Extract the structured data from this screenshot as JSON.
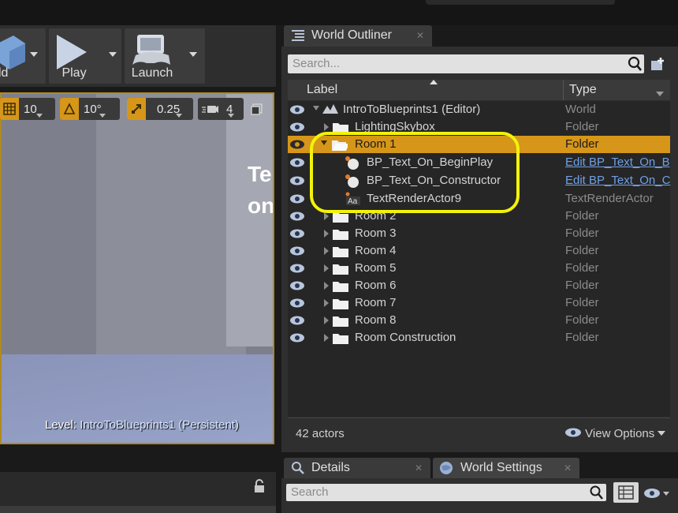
{
  "toolbar": {
    "buttons": [
      {
        "label": "ld"
      },
      {
        "label": "Play"
      },
      {
        "label": "Launch"
      }
    ]
  },
  "viewport": {
    "grid_snap_value": "10",
    "rotation_snap_value": "10°",
    "scale_snap_value": "0.25",
    "camera_speed_value": "4",
    "overlay_text_line1": "Te",
    "overlay_text_line2": "on",
    "level_prefix": "Level:",
    "level_name": "IntroToBlueprints1 (Persistent)"
  },
  "outliner": {
    "tab_title": "World Outliner",
    "search_placeholder": "Search...",
    "col_label": "Label",
    "col_type": "Type",
    "rows": [
      {
        "label": "IntroToBlueprints1 (Editor)",
        "type": "World"
      },
      {
        "label": "LightingSkybox",
        "type": "Folder"
      },
      {
        "label": "Room 1",
        "type": "Folder"
      },
      {
        "label": "BP_Text_On_BeginPlay",
        "type": "Edit BP_Text_On_B"
      },
      {
        "label": "BP_Text_On_Constructor",
        "type": "Edit BP_Text_On_C"
      },
      {
        "label": "TextRenderActor9",
        "type": "TextRenderActor"
      },
      {
        "label": "Room 2",
        "type": "Folder"
      },
      {
        "label": "Room 3",
        "type": "Folder"
      },
      {
        "label": "Room 4",
        "type": "Folder"
      },
      {
        "label": "Room 5",
        "type": "Folder"
      },
      {
        "label": "Room 6",
        "type": "Folder"
      },
      {
        "label": "Room 7",
        "type": "Folder"
      },
      {
        "label": "Room 8",
        "type": "Folder"
      },
      {
        "label": "Room Construction",
        "type": "Folder"
      }
    ],
    "actor_count": "42 actors",
    "view_options": "View Options"
  },
  "details": {
    "tab_details": "Details",
    "tab_world_settings": "World Settings",
    "search_placeholder": "Search"
  },
  "colors": {
    "selection": "#d69619",
    "highlight_ring": "#f2f20a",
    "link": "#6fa0e6"
  }
}
